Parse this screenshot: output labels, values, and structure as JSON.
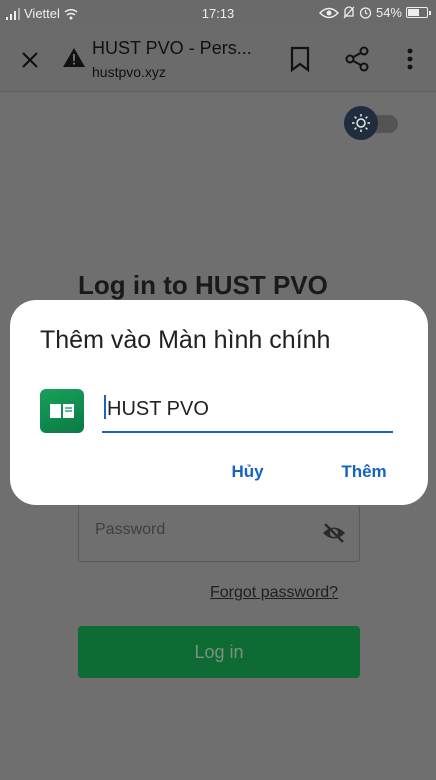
{
  "status_bar": {
    "carrier": "Viettel",
    "time": "17:13",
    "battery": "54%",
    "battery_level": 0.54
  },
  "browser": {
    "tab_title": "HUST PVO - Pers...",
    "url": "hustpvo.xyz",
    "icons": [
      "close-icon",
      "warning-icon",
      "bookmark-icon",
      "share-icon",
      "more-vert-icon"
    ]
  },
  "page": {
    "heading": "Log in to HUST PVO",
    "password_placeholder": "Password",
    "forgot_password": "Forgot password?",
    "login_button": "Log in",
    "theme_toggle_state": "dark"
  },
  "dialog": {
    "title": "Thêm vào Màn hình chính",
    "app_name_value": "HUST PVO",
    "cancel_label": "Hủy",
    "add_label": "Thêm"
  },
  "colors": {
    "accent": "#1565c0",
    "login_button": "#0e6b34",
    "app_icon": "#12915a",
    "scrim": "#6f6f6f"
  }
}
